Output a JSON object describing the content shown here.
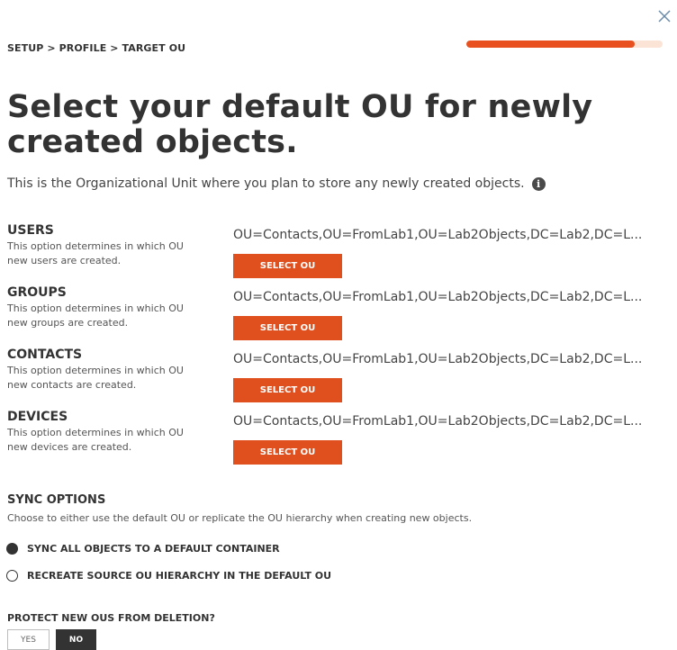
{
  "header": {
    "breadcrumb": "SETUP > PROFILE > TARGET OU",
    "progress_fraction": 0.86,
    "close_icon": "close-icon"
  },
  "main": {
    "title": "Select your default OU for newly created objects.",
    "subtitle": "This is the Organizational Unit where you plan to store any newly created objects.",
    "info_icon": "info-icon",
    "info_glyph": "i"
  },
  "ou_sections": [
    {
      "name": "USERS",
      "description": "This option determines in which OU new users are created.",
      "value": "OU=Contacts,OU=FromLab1,OU=Lab2Objects,DC=Lab2,DC=L...",
      "button_label": "SELECT OU"
    },
    {
      "name": "GROUPS",
      "description": "This option determines in which OU new groups are created.",
      "value": "OU=Contacts,OU=FromLab1,OU=Lab2Objects,DC=Lab2,DC=L...",
      "button_label": "SELECT OU"
    },
    {
      "name": "CONTACTS",
      "description": "This option determines in which OU new contacts are created.",
      "value": "OU=Contacts,OU=FromLab1,OU=Lab2Objects,DC=Lab2,DC=L...",
      "button_label": "SELECT OU"
    },
    {
      "name": "DEVICES",
      "description": "This option determines in which OU new devices are created.",
      "value": "OU=Contacts,OU=FromLab1,OU=Lab2Objects,DC=Lab2,DC=L...",
      "button_label": "SELECT OU"
    }
  ],
  "sync_options": {
    "title": "SYNC OPTIONS",
    "description": "Choose to either use the default OU or replicate the OU hierarchy when creating new objects.",
    "options": [
      {
        "label": "SYNC ALL OBJECTS TO A DEFAULT CONTAINER",
        "selected": true
      },
      {
        "label": "RECREATE SOURCE OU HIERARCHY IN THE DEFAULT OU",
        "selected": false
      }
    ]
  },
  "protect": {
    "title": "PROTECT NEW OUS FROM DELETION?",
    "yes_label": "YES",
    "no_label": "NO",
    "selected": "NO"
  },
  "colors": {
    "accent": "#e0501f",
    "progress_track": "#fbe3d6",
    "text_dark": "#333333"
  }
}
